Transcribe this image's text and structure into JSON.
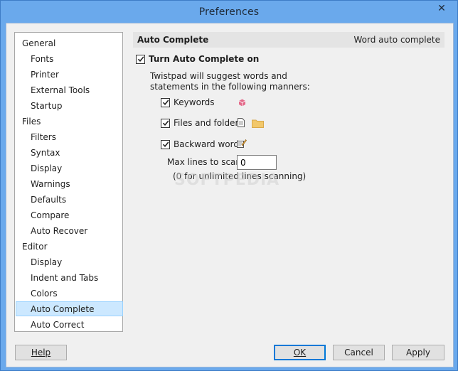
{
  "window": {
    "title": "Preferences",
    "close_glyph": "✕"
  },
  "nav": {
    "items": [
      {
        "label": "General",
        "level": 0
      },
      {
        "label": "Fonts",
        "level": 1
      },
      {
        "label": "Printer",
        "level": 1
      },
      {
        "label": "External Tools",
        "level": 1
      },
      {
        "label": "Startup",
        "level": 1
      },
      {
        "label": "Files",
        "level": 0
      },
      {
        "label": "Filters",
        "level": 1
      },
      {
        "label": "Syntax",
        "level": 1
      },
      {
        "label": "Display",
        "level": 1
      },
      {
        "label": "Warnings",
        "level": 1
      },
      {
        "label": "Defaults",
        "level": 1
      },
      {
        "label": "Compare",
        "level": 1
      },
      {
        "label": "Auto Recover",
        "level": 1
      },
      {
        "label": "Editor",
        "level": 0
      },
      {
        "label": "Display",
        "level": 1
      },
      {
        "label": "Indent and Tabs",
        "level": 1
      },
      {
        "label": "Colors",
        "level": 1
      },
      {
        "label": "Auto Complete",
        "level": 1,
        "selected": true
      },
      {
        "label": "Auto Correct",
        "level": 1
      }
    ]
  },
  "panel": {
    "title": "Auto Complete",
    "subtitle": "Word auto complete",
    "turn_on": {
      "label": "Turn Auto Complete on",
      "checked": true
    },
    "description_line1": "Twistpad will suggest words and",
    "description_line2": "statements in the following manners:",
    "options": {
      "keywords": {
        "label": "Keywords",
        "checked": true,
        "icon": "pink-cube-icon"
      },
      "files": {
        "label": "Files and folders",
        "checked": true,
        "icon": "file-folder-icon"
      },
      "backward": {
        "label": "Backward words",
        "checked": true,
        "icon": "edit-words-icon"
      }
    },
    "max_lines_label": "Max lines to scan:",
    "max_lines_value": "0",
    "max_lines_note": "(0 for unlimited lines scanning)"
  },
  "buttons": {
    "help": "Help",
    "ok": "OK",
    "cancel": "Cancel",
    "apply": "Apply"
  },
  "watermark": "SOFTPEDIA"
}
